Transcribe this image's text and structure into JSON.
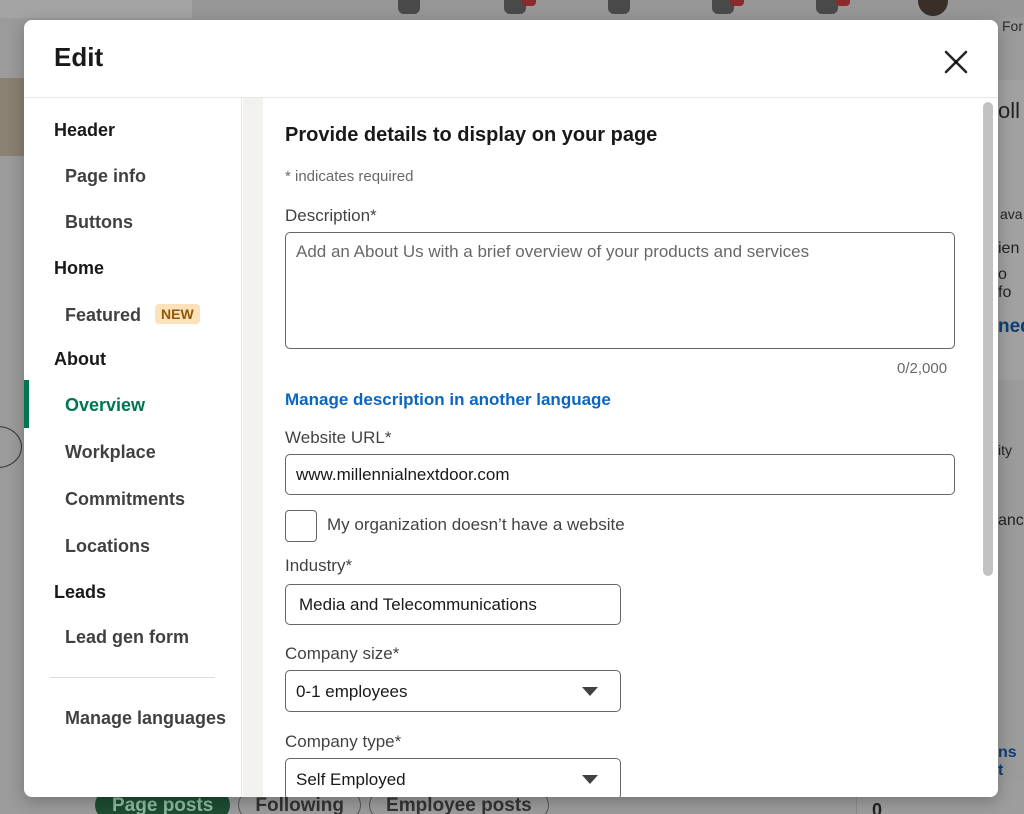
{
  "background": {
    "corner_text": "For",
    "right_snippets": [
      "oll",
      "ava",
      "ien",
      "o fo",
      "ned",
      "ity",
      "anc",
      "ns t"
    ],
    "tabs": [
      {
        "label": "Page posts",
        "active": true
      },
      {
        "label": "Following",
        "active": false
      },
      {
        "label": "Employee posts",
        "active": false
      }
    ],
    "right_number": "0"
  },
  "modal": {
    "title": "Edit",
    "close_icon": "close-icon"
  },
  "sidebar": {
    "sections": [
      {
        "label": "Header",
        "items": [
          {
            "label": "Page info"
          },
          {
            "label": "Buttons"
          }
        ]
      },
      {
        "label": "Home",
        "items": [
          {
            "label": "Featured",
            "badge": "NEW"
          }
        ]
      },
      {
        "label": "About",
        "items": [
          {
            "label": "Overview",
            "active": true
          },
          {
            "label": "Workplace"
          },
          {
            "label": "Commitments"
          },
          {
            "label": "Locations"
          }
        ]
      },
      {
        "label": "Leads",
        "items": [
          {
            "label": "Lead gen form"
          }
        ]
      }
    ],
    "footer_item": "Manage languages",
    "active_color": "#01754f"
  },
  "form": {
    "heading": "Provide details to display on your page",
    "required_note": "* indicates required",
    "description": {
      "label": "Description*",
      "value": "",
      "placeholder": "Add an About Us with a brief overview of your products and services",
      "counter": "0/2,000"
    },
    "manage_language_link": "Manage description in another language",
    "website": {
      "label": "Website URL*",
      "value": "www.millennialnextdoor.com"
    },
    "no_website_checkbox": {
      "label": "My organization doesn’t have a website",
      "checked": false
    },
    "industry": {
      "label": "Industry*",
      "value": "Media and Telecommunications"
    },
    "company_size": {
      "label": "Company size*",
      "value": "0-1 employees"
    },
    "company_type": {
      "label": "Company type*",
      "value": "Self Employed"
    },
    "link_color": "#0a66c2"
  }
}
